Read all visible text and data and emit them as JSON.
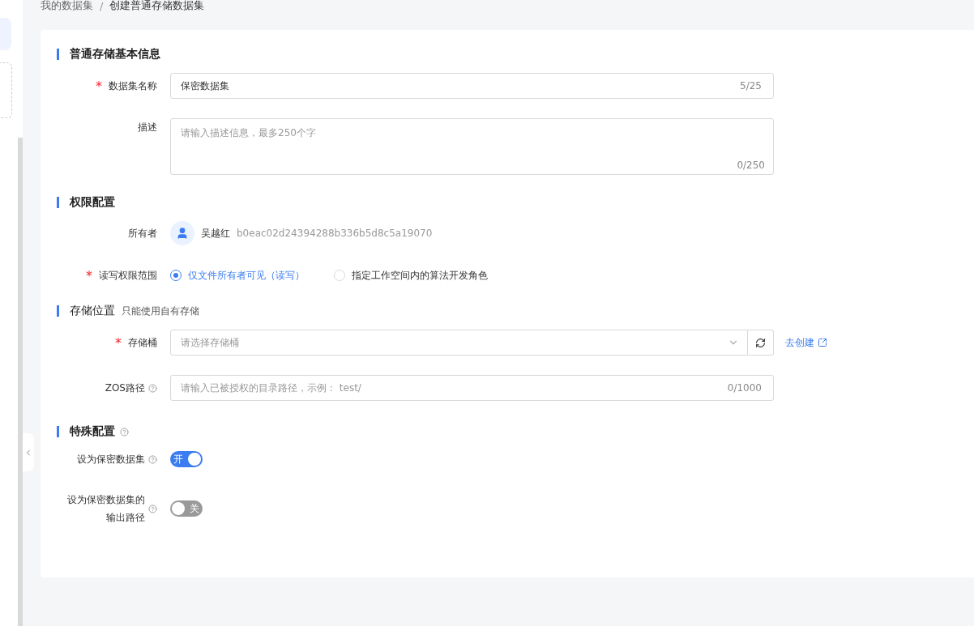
{
  "breadcrumb": [
    {
      "label": "我的数据集"
    },
    {
      "label": "创建普通存储数据集"
    }
  ],
  "breadcrumb_separator": "/",
  "required_mark": "*",
  "sections": [
    {
      "title": "普通存储基本信息",
      "rows": [
        {
          "kind": "input",
          "label": "数据集名称",
          "required": true,
          "value": "保密数据集",
          "counter": "5/25"
        },
        {
          "kind": "textarea",
          "label": "描述",
          "placeholder": "请输入描述信息，最多250个字",
          "counter": "0/250"
        }
      ]
    },
    {
      "title": "权限配置",
      "rows": [
        {
          "kind": "owner",
          "label": "所有者",
          "name": "吴越红",
          "user_id": "b0eac02d24394288b336b5d8c5a19070"
        },
        {
          "kind": "radio",
          "label": "读写权限范围",
          "required": true,
          "options": [
            {
              "label": "仅文件所有者可见（读写）",
              "selected": true
            },
            {
              "label": "指定工作空间内的算法开发角色",
              "selected": false
            }
          ]
        }
      ]
    },
    {
      "title": "存储位置",
      "note": "只能使用自有存储",
      "rows": [
        {
          "kind": "select",
          "label": "存储桶",
          "required": true,
          "placeholder": "请选择存储桶",
          "link": "去创建"
        },
        {
          "kind": "input",
          "label": "ZOS路径",
          "help": true,
          "placeholder": "请输入已被授权的目录路径，示例： test/",
          "counter": "0/1000"
        }
      ]
    },
    {
      "title": "特殊配置",
      "help": true,
      "rows": [
        {
          "kind": "switch",
          "label": "设为保密数据集",
          "help": true,
          "on": true,
          "text": "开"
        },
        {
          "kind": "switch",
          "label": "设为保密数据集的输出路径",
          "help": true,
          "on": false,
          "text": "关"
        }
      ]
    }
  ]
}
